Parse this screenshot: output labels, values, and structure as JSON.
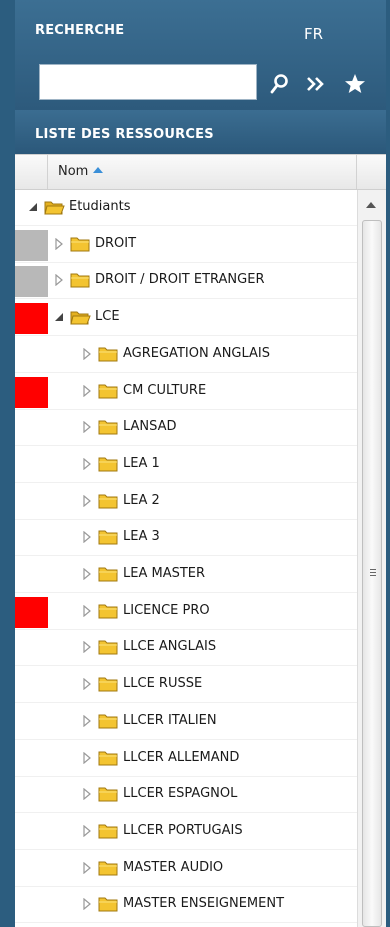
{
  "search": {
    "title": "RECHERCHE",
    "language": "FR",
    "query": "",
    "placeholder": ""
  },
  "icons": {
    "search": "search-icon",
    "advanced": "double-chevron-right-icon",
    "favorite": "star-icon",
    "expanded": "triangle-down-icon",
    "collapsed": "triangle-right-icon",
    "folder": "folder-icon"
  },
  "colors": {
    "panel_header": "#2d5a7c",
    "flag_gray": "#b8b8b8",
    "flag_red": "#ff0000",
    "folder_yellow": "#f3c431",
    "sort_arrow": "#3a8fd8"
  },
  "list": {
    "title": "LISTE DES RESSOURCES",
    "column_name": "Nom",
    "rows": [
      {
        "label": "Etudiants",
        "depth": 0,
        "expanded": true,
        "flag": "none"
      },
      {
        "label": "DROIT",
        "depth": 1,
        "expanded": false,
        "flag": "gray"
      },
      {
        "label": "DROIT / DROIT ETRANGER",
        "depth": 1,
        "expanded": false,
        "flag": "gray"
      },
      {
        "label": "LCE",
        "depth": 1,
        "expanded": true,
        "flag": "red"
      },
      {
        "label": "AGREGATION ANGLAIS",
        "depth": 2,
        "expanded": false,
        "flag": "none"
      },
      {
        "label": "CM CULTURE",
        "depth": 2,
        "expanded": false,
        "flag": "red"
      },
      {
        "label": "LANSAD",
        "depth": 2,
        "expanded": false,
        "flag": "none"
      },
      {
        "label": "LEA 1",
        "depth": 2,
        "expanded": false,
        "flag": "none"
      },
      {
        "label": "LEA 2",
        "depth": 2,
        "expanded": false,
        "flag": "none"
      },
      {
        "label": "LEA 3",
        "depth": 2,
        "expanded": false,
        "flag": "none"
      },
      {
        "label": "LEA MASTER",
        "depth": 2,
        "expanded": false,
        "flag": "none"
      },
      {
        "label": "LICENCE PRO",
        "depth": 2,
        "expanded": false,
        "flag": "red"
      },
      {
        "label": "LLCE ANGLAIS",
        "depth": 2,
        "expanded": false,
        "flag": "none"
      },
      {
        "label": "LLCE RUSSE",
        "depth": 2,
        "expanded": false,
        "flag": "none"
      },
      {
        "label": "LLCER ITALIEN",
        "depth": 2,
        "expanded": false,
        "flag": "none"
      },
      {
        "label": "LLCER ALLEMAND",
        "depth": 2,
        "expanded": false,
        "flag": "none"
      },
      {
        "label": "LLCER ESPAGNOL",
        "depth": 2,
        "expanded": false,
        "flag": "none"
      },
      {
        "label": "LLCER PORTUGAIS",
        "depth": 2,
        "expanded": false,
        "flag": "none"
      },
      {
        "label": "MASTER AUDIO",
        "depth": 2,
        "expanded": false,
        "flag": "none"
      },
      {
        "label": "MASTER ENSEIGNEMENT",
        "depth": 2,
        "expanded": false,
        "flag": "none"
      }
    ]
  }
}
